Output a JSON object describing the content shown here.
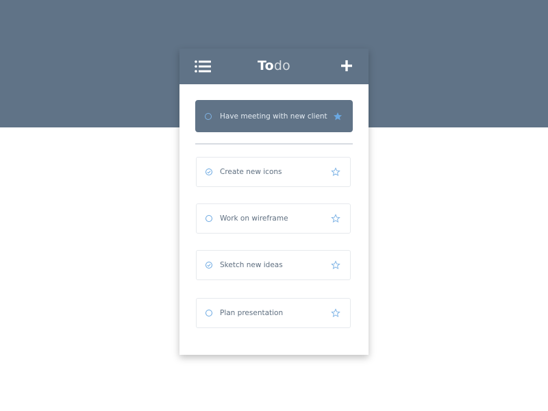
{
  "app": {
    "title_part1": "To",
    "title_part2": "do"
  },
  "colors": {
    "header": "#607387",
    "accent": "#6aa8e2",
    "text": "#5f6f80"
  },
  "icons": {
    "menu": "list-menu-icon",
    "add": "plus-icon",
    "check_empty": "circle-icon",
    "check_done": "check-circle-icon",
    "star": "star-icon"
  },
  "highlighted_item": {
    "label": "Have meeting with new client",
    "done": false,
    "starred": true
  },
  "todos": [
    {
      "label": "Create new icons",
      "done": true,
      "starred": false
    },
    {
      "label": "Work on wireframe",
      "done": false,
      "starred": false
    },
    {
      "label": "Sketch new ideas",
      "done": true,
      "starred": false
    },
    {
      "label": "Plan presentation",
      "done": false,
      "starred": false
    }
  ]
}
